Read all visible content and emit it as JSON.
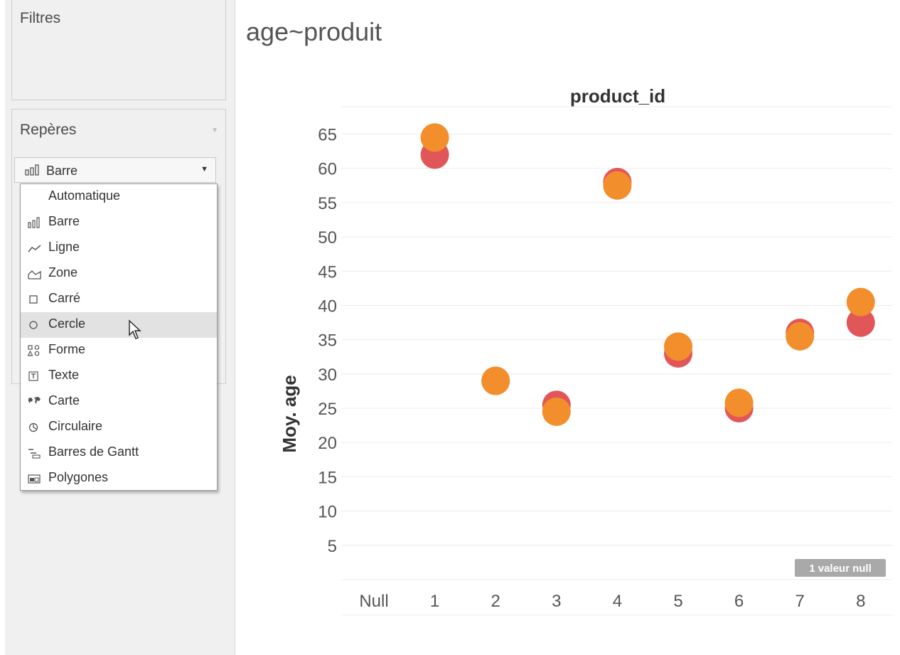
{
  "sidebar": {
    "filters_title": "Filtres",
    "marks_title": "Repères",
    "mark_type": {
      "selected": "Barre",
      "icon": "bar-chart-icon"
    },
    "dropdown_items": [
      {
        "label": "Automatique",
        "icon": ""
      },
      {
        "label": "Barre",
        "icon": "bar-chart-icon"
      },
      {
        "label": "Ligne",
        "icon": "line-icon"
      },
      {
        "label": "Zone",
        "icon": "area-icon"
      },
      {
        "label": "Carré",
        "icon": "square-icon"
      },
      {
        "label": "Cercle",
        "icon": "circle-icon",
        "hovered": true
      },
      {
        "label": "Forme",
        "icon": "shapes-icon"
      },
      {
        "label": "Texte",
        "icon": "text-icon"
      },
      {
        "label": "Carte",
        "icon": "map-icon"
      },
      {
        "label": "Circulaire",
        "icon": "pie-icon"
      },
      {
        "label": "Barres de Gantt",
        "icon": "gantt-icon"
      },
      {
        "label": "Polygones",
        "icon": "polygon-icon"
      }
    ]
  },
  "sheet": {
    "title": "age~produit"
  },
  "chart_data": {
    "type": "scatter",
    "title": "product_id",
    "xlabel": "product_id",
    "ylabel": "Moy. age",
    "categories": [
      "Null",
      "1",
      "2",
      "3",
      "4",
      "5",
      "6",
      "7",
      "8"
    ],
    "yticks": [
      5,
      10,
      15,
      20,
      25,
      30,
      35,
      40,
      45,
      50,
      55,
      60,
      65
    ],
    "ylim": [
      0,
      69
    ],
    "grid": true,
    "colors": {
      "red": "#e15759",
      "orange": "#f28e2b"
    },
    "series": [
      {
        "color": "#e15759",
        "values": [
          null,
          62,
          29,
          25.5,
          58,
          33,
          25,
          36,
          37.5
        ]
      },
      {
        "color": "#f28e2b",
        "values": [
          null,
          64.5,
          29,
          24.5,
          57.5,
          34,
          25.8,
          35.5,
          40.5
        ]
      }
    ],
    "null_badge": "1 valeur null"
  }
}
